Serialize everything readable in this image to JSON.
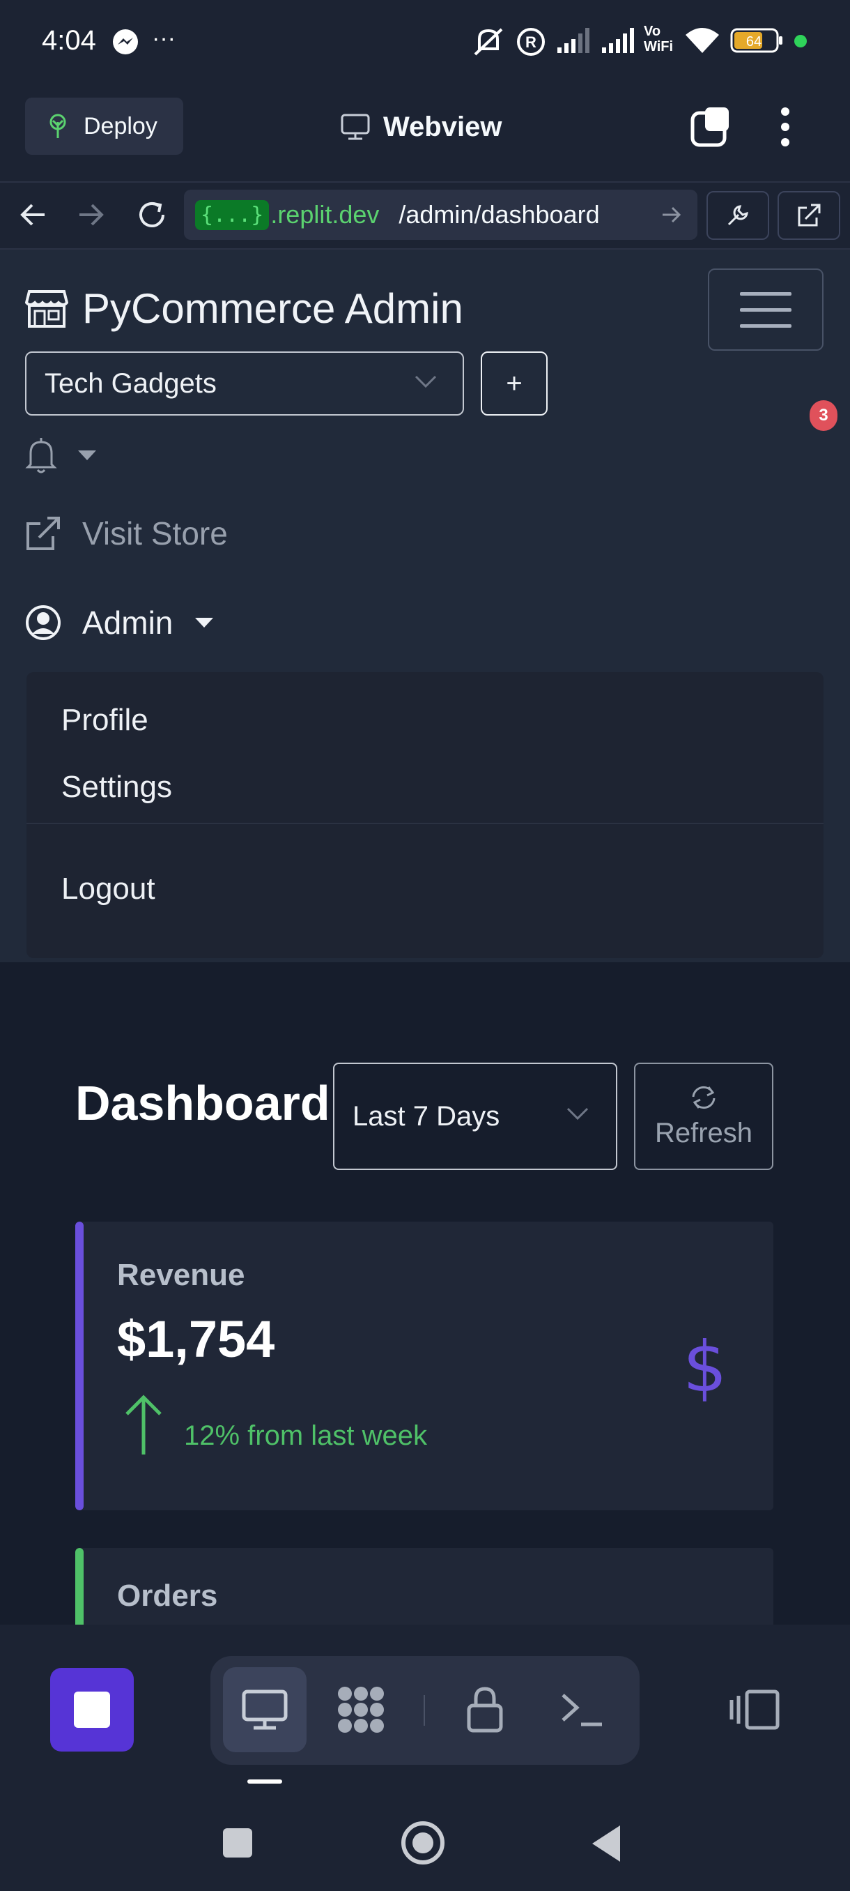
{
  "status_bar": {
    "time": "4:04",
    "battery": "64",
    "more": "···"
  },
  "replit_header": {
    "deploy_label": "Deploy",
    "title": "Webview"
  },
  "url_bar": {
    "badge": "{...}",
    "host": ".replit.dev",
    "path": "/admin/dashboard"
  },
  "navbar": {
    "brand": "PyCommerce Admin",
    "store_selected": "Tech Gadgets",
    "add_store_label": "+",
    "notification_count": "3",
    "visit_store_label": "Visit Store",
    "user_label": "Admin",
    "user_menu": [
      "Profile",
      "Settings",
      "Logout"
    ]
  },
  "dashboard": {
    "title": "Dashboard",
    "range_selected": "Last 7 Days",
    "refresh_label": "Refresh",
    "cards": [
      {
        "label": "Revenue",
        "value": "$1,754",
        "trend": "12% from last week",
        "icon": "dollar-icon",
        "accent": "#6a4fdc",
        "trend_color": "#4fc168"
      },
      {
        "label": "Orders",
        "accent": "#4fc168"
      }
    ]
  },
  "bottom_tabs": [
    "webview-tab",
    "workspace-tab",
    "secrets-tab",
    "shell-tab"
  ],
  "colors": {
    "brand_purple": "#5634d6",
    "page_bg": "#1c2333",
    "success": "#4fc168",
    "danger": "#e0515b"
  }
}
